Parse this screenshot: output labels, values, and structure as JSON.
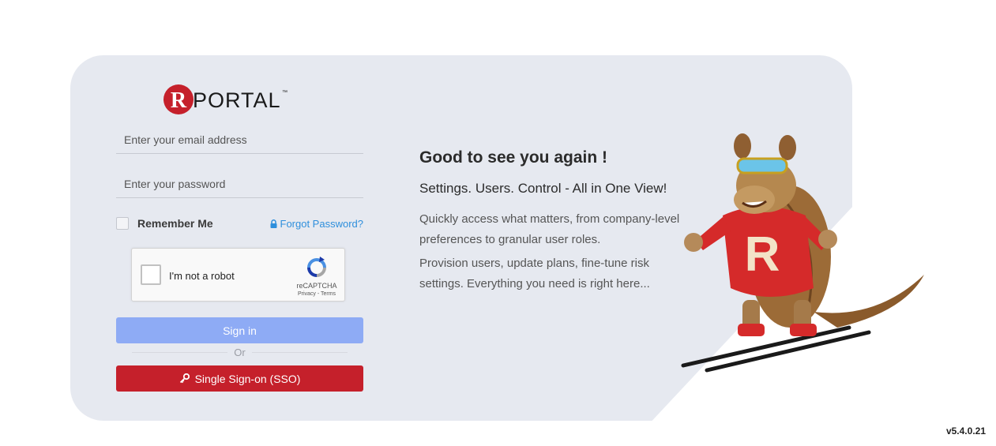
{
  "brand": {
    "logo_letter": "R",
    "logo_text": "PORTAL",
    "trademark": "™",
    "colors": {
      "primary_red": "#c5202b",
      "link_blue": "#2e8fdc",
      "signin_blue": "#8eabf5",
      "card_bg": "#e6e9f0"
    }
  },
  "login": {
    "email_placeholder": "Enter your email address",
    "password_placeholder": "Enter your password",
    "remember_label": "Remember Me",
    "remember_checked": false,
    "forgot_label": "Forgot Password?",
    "forgot_icon": "lock-icon",
    "captcha": {
      "label": "I'm not a robot",
      "brand": "reCAPTCHA",
      "links": "Privacy - Terms"
    },
    "signin_label": "Sign in",
    "or_label": "Or",
    "sso_label": "Single Sign-on (SSO)",
    "sso_icon": "key-icon"
  },
  "welcome": {
    "headline": "Good to see you again !",
    "subheadline": "Settings. Users. Control - All in One View!",
    "paragraphs": [
      "Quickly access what matters, from company-level preferences to granular user roles.",
      "Provision users, update plans, fine-tune risk settings. Everything you need is right here..."
    ]
  },
  "mascot": {
    "sweater_letter": "R"
  },
  "footer": {
    "version": "v5.4.0.21"
  }
}
